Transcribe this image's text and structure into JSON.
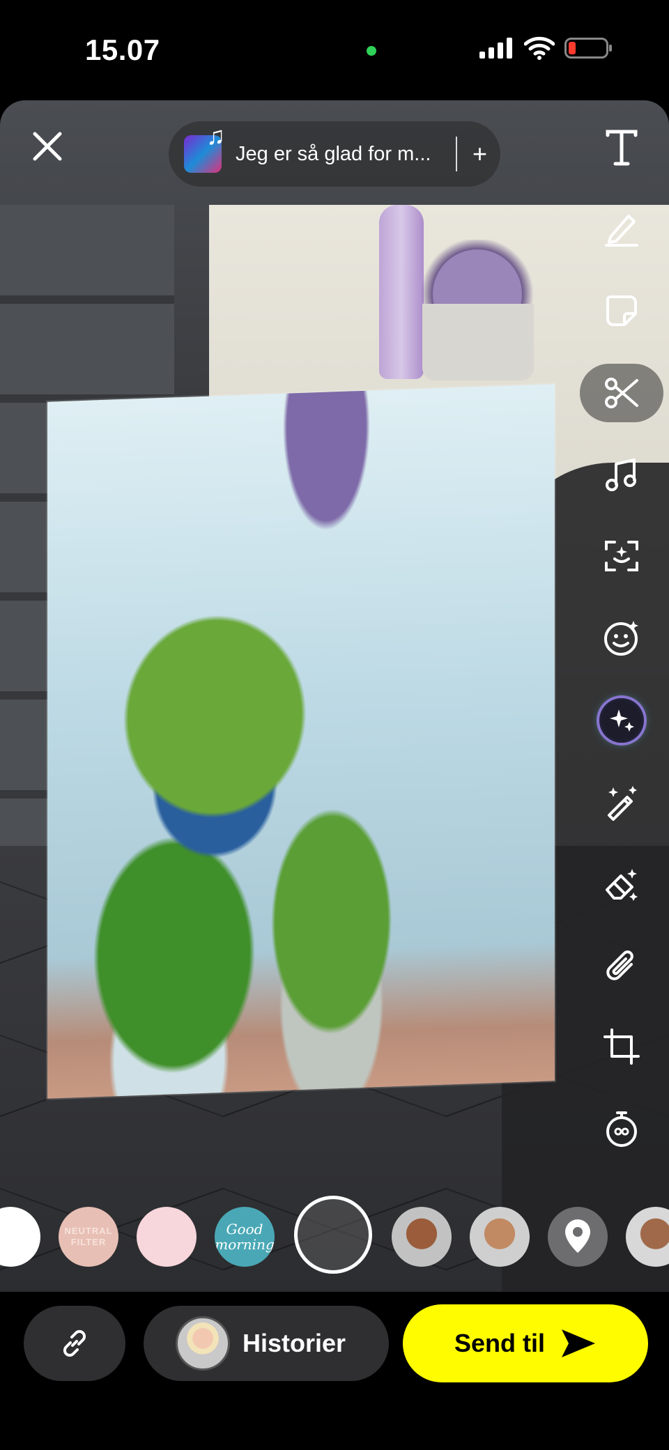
{
  "status_bar": {
    "time": "15.07",
    "privacy_dot_color": "#2fd158",
    "icons": [
      "signal-icon",
      "wifi-icon",
      "battery-icon"
    ]
  },
  "music": {
    "title": "Jeg er så glad for m...",
    "add_label": "+"
  },
  "toolbar": {
    "items": [
      "text-icon",
      "pencil-icon",
      "sticker-icon",
      "scissors-icon",
      "music-note-icon",
      "scan-icon",
      "emoji-icon",
      "ai-sparkle-icon",
      "magic-eraser-icon",
      "eraser-icon",
      "paperclip-icon",
      "crop-icon",
      "timer-icon"
    ]
  },
  "lenses": {
    "neutral_label": "NEUTRAL FILTER",
    "good_morning_label": "Good morning",
    "items": [
      "white-filter",
      "neutral-filter",
      "pink-filter",
      "good-morning-sticker",
      "capture",
      "face-lens-1",
      "face-lens-2",
      "location-filter",
      "face-lens-3"
    ]
  },
  "bottom": {
    "stories_label": "Historier",
    "send_label": "Send til",
    "accent_color": "#fffc00"
  }
}
